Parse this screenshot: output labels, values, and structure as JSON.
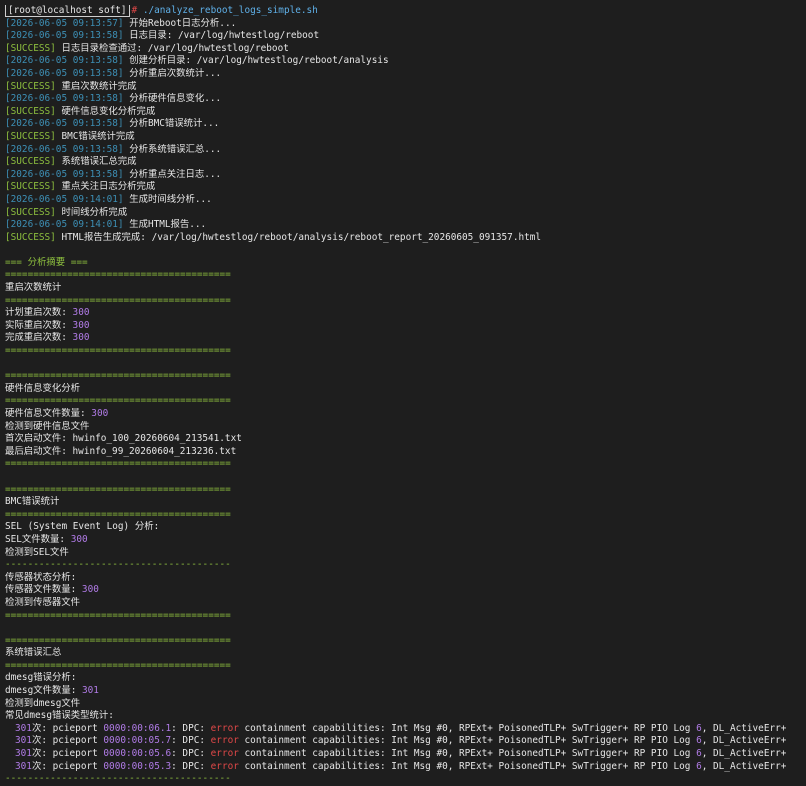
{
  "prompt": {
    "user_host": "[root@localhost soft]",
    "hash": "#",
    "command": "./analyze_reboot_logs_simple.sh"
  },
  "log_lines": [
    {
      "tag": "[2026-06-05 09:13:57]",
      "kind": "info",
      "text": "开始Reboot日志分析..."
    },
    {
      "tag": "[2026-06-05 09:13:58]",
      "kind": "info",
      "text": "日志目录: /var/log/hwtestlog/reboot"
    },
    {
      "tag": "[SUCCESS]",
      "kind": "ok",
      "text": "日志目录检查通过: /var/log/hwtestlog/reboot"
    },
    {
      "tag": "[2026-06-05 09:13:58]",
      "kind": "info",
      "text": "创建分析目录: /var/log/hwtestlog/reboot/analysis"
    },
    {
      "tag": "[2026-06-05 09:13:58]",
      "kind": "info",
      "text": "分析重启次数统计..."
    },
    {
      "tag": "[SUCCESS]",
      "kind": "ok",
      "text": "重启次数统计完成"
    },
    {
      "tag": "[2026-06-05 09:13:58]",
      "kind": "info",
      "text": "分析硬件信息变化..."
    },
    {
      "tag": "[SUCCESS]",
      "kind": "ok",
      "text": "硬件信息变化分析完成"
    },
    {
      "tag": "[2026-06-05 09:13:58]",
      "kind": "info",
      "text": "分析BMC错误统计..."
    },
    {
      "tag": "[SUCCESS]",
      "kind": "ok",
      "text": "BMC错误统计完成"
    },
    {
      "tag": "[2026-06-05 09:13:58]",
      "kind": "info",
      "text": "分析系统错误汇总..."
    },
    {
      "tag": "[SUCCESS]",
      "kind": "ok",
      "text": "系统错误汇总完成"
    },
    {
      "tag": "[2026-06-05 09:13:58]",
      "kind": "info",
      "text": "分析重点关注日志..."
    },
    {
      "tag": "[SUCCESS]",
      "kind": "ok",
      "text": "重点关注日志分析完成"
    },
    {
      "tag": "[2026-06-05 09:14:01]",
      "kind": "info",
      "text": "生成时间线分析..."
    },
    {
      "tag": "[SUCCESS]",
      "kind": "ok",
      "text": "时间线分析完成"
    },
    {
      "tag": "[2026-06-05 09:14:01]",
      "kind": "info",
      "text": "生成HTML报告..."
    },
    {
      "tag": "[SUCCESS]",
      "kind": "ok",
      "text": "HTML报告生成完成: /var/log/hwtestlog/reboot/analysis/reboot_report_20260605_091357.html"
    }
  ],
  "summary_header": "=== 分析摘要 ===",
  "rule_eq": "========================================",
  "rule_dash": "----------------------------------------",
  "reboot": {
    "title": "重启次数统计",
    "rows": [
      {
        "label": "计划重启次数: ",
        "value": "300"
      },
      {
        "label": "实际重启次数: ",
        "value": "300"
      },
      {
        "label": "完成重启次数: ",
        "value": "300"
      }
    ]
  },
  "hw": {
    "title": "硬件信息变化分析",
    "count_label": "硬件信息文件数量: ",
    "count_value": "300",
    "detected": "检测到硬件信息文件",
    "first": "首次启动文件: hwinfo_100_20260604_213541.txt",
    "last": "最后启动文件: hwinfo_99_20260604_213236.txt"
  },
  "bmc": {
    "title": "BMC错误统计",
    "sel_title": "SEL (System Event Log) 分析:",
    "sel_count_label": "SEL文件数量: ",
    "sel_count_value": "300",
    "sel_detected": "检测到SEL文件",
    "sensor_title": "传感器状态分析:",
    "sensor_count_label": "传感器文件数量: ",
    "sensor_count_value": "300",
    "sensor_detected": "检测到传感器文件"
  },
  "sys": {
    "title": "系统错误汇总",
    "dmesg_title": "dmesg错误分析:",
    "dmesg_count_label": "dmesg文件数量: ",
    "dmesg_count_value": "301",
    "dmesg_detected": "检测到dmesg文件",
    "types_title": "常见dmesg错误类型统计:",
    "errors": [
      {
        "count": "301",
        "mid": "次: pcieport ",
        "addr": "0000:00:06.1",
        "pre": ": DPC: ",
        "err": "error",
        "post": " containment capabilities: Int Msg #0, RPExt+ PoisonedTLP+ SwTrigger+ RP PIO Log ",
        "log": "6",
        "tail": ", DL_ActiveErr+"
      },
      {
        "count": "301",
        "mid": "次: pcieport ",
        "addr": "0000:00:05.7",
        "pre": ": DPC: ",
        "err": "error",
        "post": " containment capabilities: Int Msg #0, RPExt+ PoisonedTLP+ SwTrigger+ RP PIO Log ",
        "log": "6",
        "tail": ", DL_ActiveErr+"
      },
      {
        "count": "301",
        "mid": "次: pcieport ",
        "addr": "0000:00:05.6",
        "pre": ": DPC: ",
        "err": "error",
        "post": " containment capabilities: Int Msg #0, RPExt+ PoisonedTLP+ SwTrigger+ RP PIO Log ",
        "log": "6",
        "tail": ", DL_ActiveErr+"
      },
      {
        "count": "301",
        "mid": "次: pcieport ",
        "addr": "0000:00:05.3",
        "pre": ": DPC: ",
        "err": "error",
        "post": " containment capabilities: Int Msg #0, RPExt+ PoisonedTLP+ SwTrigger+ RP PIO Log ",
        "log": "6",
        "tail": ", DL_ActiveErr+"
      }
    ]
  },
  "colors": {
    "background": "#1e1e1e",
    "success": "#8ec03f",
    "timestamp": "#3d8fb5",
    "number": "#b07be6",
    "error": "#e04848"
  }
}
